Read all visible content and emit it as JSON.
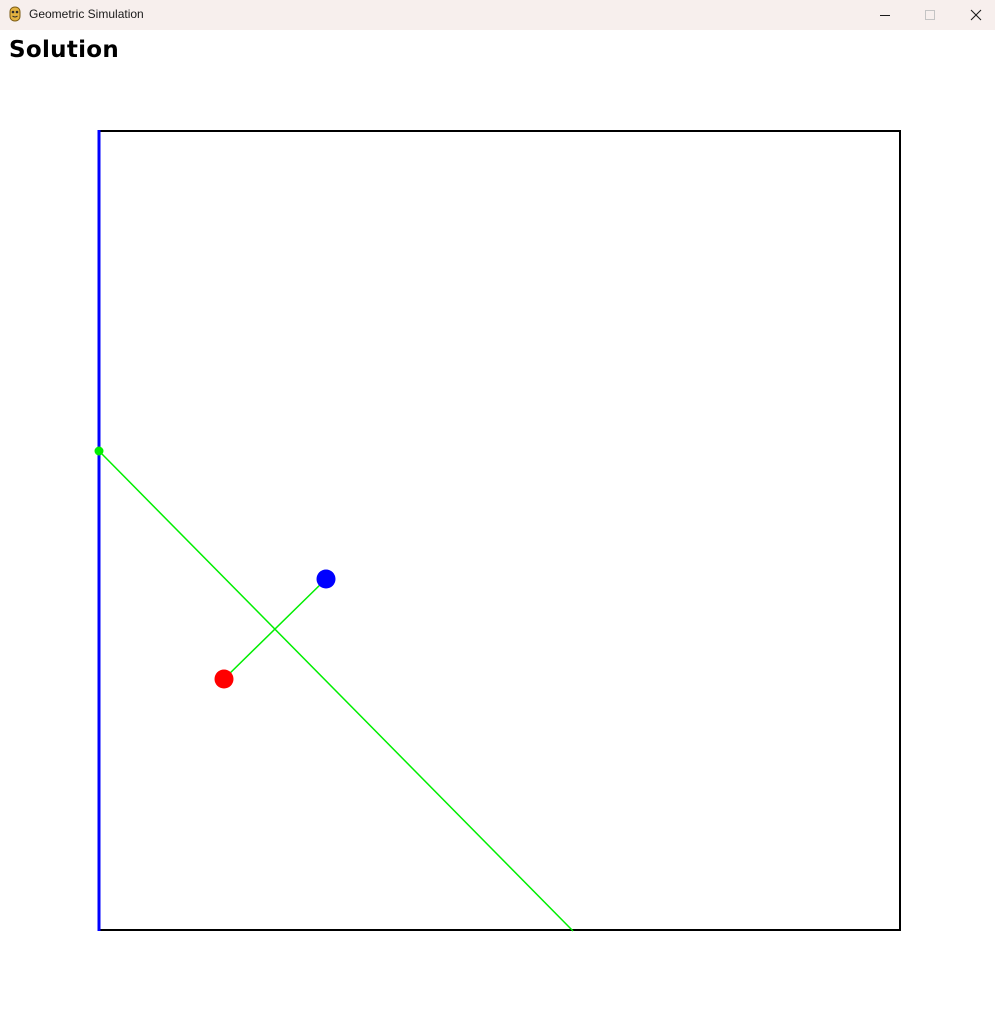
{
  "window": {
    "title": "Geometric Simulation"
  },
  "titlebar": {
    "icons": {
      "app": "python-icon",
      "minimize": "minimize-icon",
      "maximize": "maximize-icon",
      "close": "close-icon"
    }
  },
  "canvas": {
    "heading": "Solution"
  },
  "colors": {
    "titlebar_bg": "#f7efed",
    "box_border": "#000000",
    "highlighted_wall": "#0000ff",
    "line": "#00ee00",
    "red_point": "#ff0000",
    "blue_point": "#0000ff"
  }
}
